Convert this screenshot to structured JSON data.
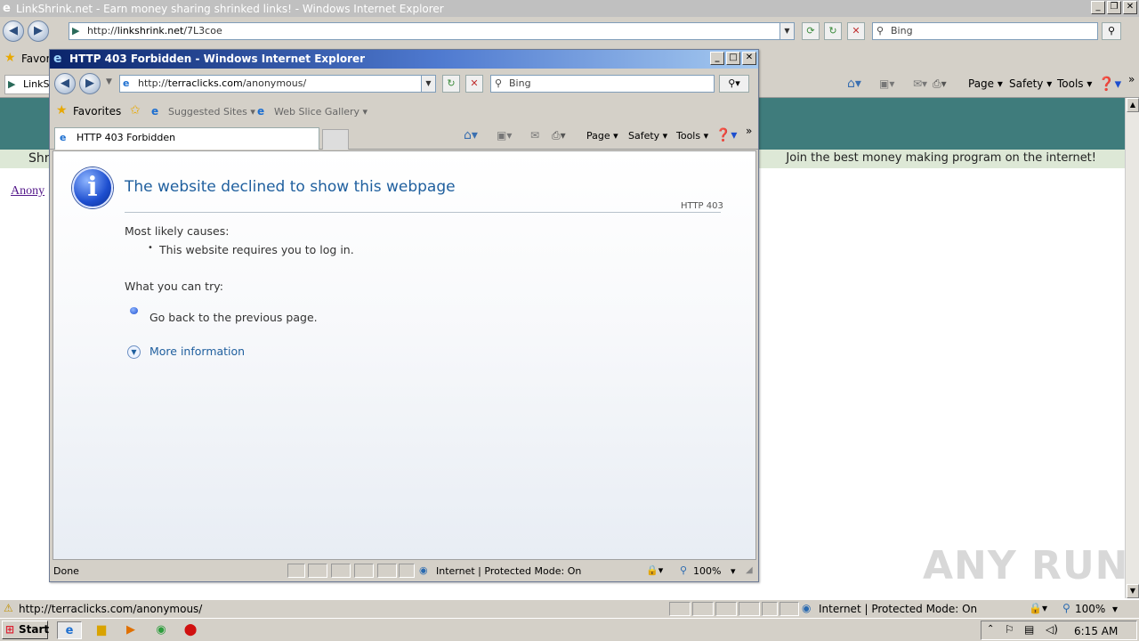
{
  "bg_window": {
    "title": "LinkShrink.net - Earn money sharing shrinked links! - Windows Internet Explorer",
    "address_prefix": "http://",
    "address_host": "linkshrink.net",
    "address_path": "/7L3coe",
    "search_placeholder": "Bing",
    "favorites_label": "Favori",
    "tab_label": "LinkS",
    "page_menu": "Page",
    "safety_menu": "Safety",
    "tools_menu": "Tools",
    "banner_left": "Shri",
    "banner_right": "Join the best money making program on the internet!",
    "content_link": "Anony",
    "status_url": "http://terraclicks.com/anonymous/",
    "zone_text": "Internet | Protected Mode: On",
    "zoom": "100%"
  },
  "popup": {
    "title": "HTTP 403 Forbidden - Windows Internet Explorer",
    "address_prefix": "http://",
    "address_host": "terraclicks.com",
    "address_path": "/anonymous/",
    "search_placeholder": "Bing",
    "favorites_label": "Favorites",
    "suggested_sites": "Suggested Sites",
    "web_slice_gallery": "Web Slice Gallery",
    "tab_label": "HTTP 403 Forbidden",
    "page_menu": "Page",
    "safety_menu": "Safety",
    "tools_menu": "Tools",
    "error": {
      "title": "The website declined to show this webpage",
      "code": "HTTP 403",
      "causes_heading": "Most likely causes:",
      "cause_1": "This website requires you to log in.",
      "try_heading": "What you can try:",
      "action_1": "Go back to the previous page.",
      "more_info": "More information"
    },
    "status_text": "Done",
    "zone_text": "Internet | Protected Mode: On",
    "zoom": "100%"
  },
  "taskbar": {
    "start_label": "Start",
    "clock": "6:15 AM"
  },
  "watermark": "ANY RUN",
  "colors": {
    "teal_header": "#3f7c7c",
    "title_gradient_start": "#0a246a",
    "error_title": "#1f5f9e"
  }
}
